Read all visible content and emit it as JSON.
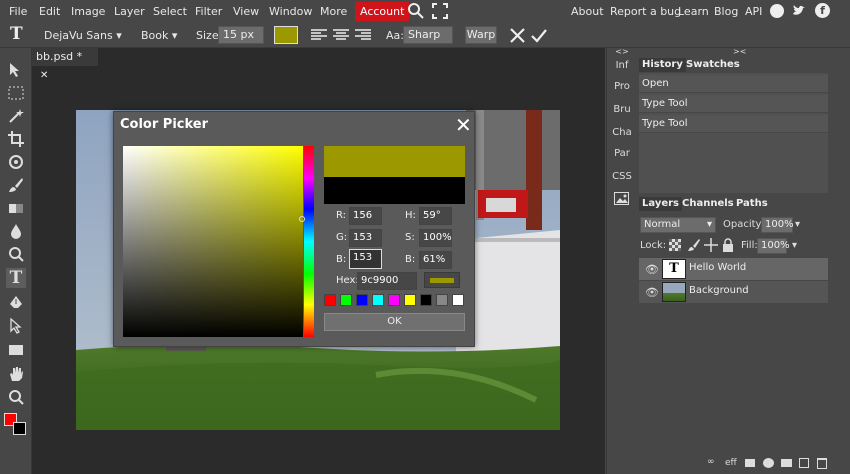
{
  "menu": {
    "items": [
      "File",
      "Edit",
      "Image",
      "Layer",
      "Select",
      "Filter",
      "View",
      "Window",
      "More"
    ],
    "account": "Account",
    "right_links": [
      "About",
      "Report a bug",
      "Learn",
      "Blog",
      "API"
    ]
  },
  "options": {
    "font_family": "DejaVu Sans ▾",
    "font_style": "Book ▾",
    "size_label": "Size:",
    "size_value": "15 px",
    "aa_label": "Aa:",
    "aa_value": "Sharp",
    "warp": "Warp",
    "text_color": "#9c9900"
  },
  "document": {
    "tab_name": "bb.psd *"
  },
  "color_picker": {
    "title": "Color Picker",
    "close": "✕",
    "fields": {
      "R": "156",
      "G": "153",
      "B": "153",
      "H": "59°",
      "S": "100%",
      "Bv": "61%",
      "hex_label": "Hex:",
      "hex": "9c9900"
    },
    "labels": {
      "r": "R:",
      "g": "G:",
      "b": "B:",
      "h": "H:",
      "s": "S:",
      "v": "B:"
    },
    "new_color": "#9c9900",
    "old_color": "#000000",
    "palette": [
      "#ff0000",
      "#00ff00",
      "#0000ff",
      "#00ffff",
      "#ff00ff",
      "#ffff00",
      "#000000",
      "#888888",
      "#ffffff"
    ],
    "ok": "OK"
  },
  "mini_panel": [
    "Inf",
    "Pro",
    "Bru",
    "Cha",
    "Par",
    "CSS"
  ],
  "panels": {
    "history": {
      "tab1": "History",
      "tab2": "Swatches",
      "rows": [
        "Open",
        "Type Tool",
        "Type Tool"
      ]
    },
    "layers": {
      "tab1": "Layers",
      "tab2": "Channels",
      "tab3": "Paths",
      "blend": "Normal",
      "opacity_label": "Opacity:",
      "opacity": "100%",
      "lock_label": "Lock:",
      "fill_label": "Fill:",
      "fill": "100%",
      "rows": [
        {
          "name": "Hello World",
          "type": "text"
        },
        {
          "name": "Background",
          "type": "image"
        }
      ],
      "footer": "eff"
    }
  }
}
